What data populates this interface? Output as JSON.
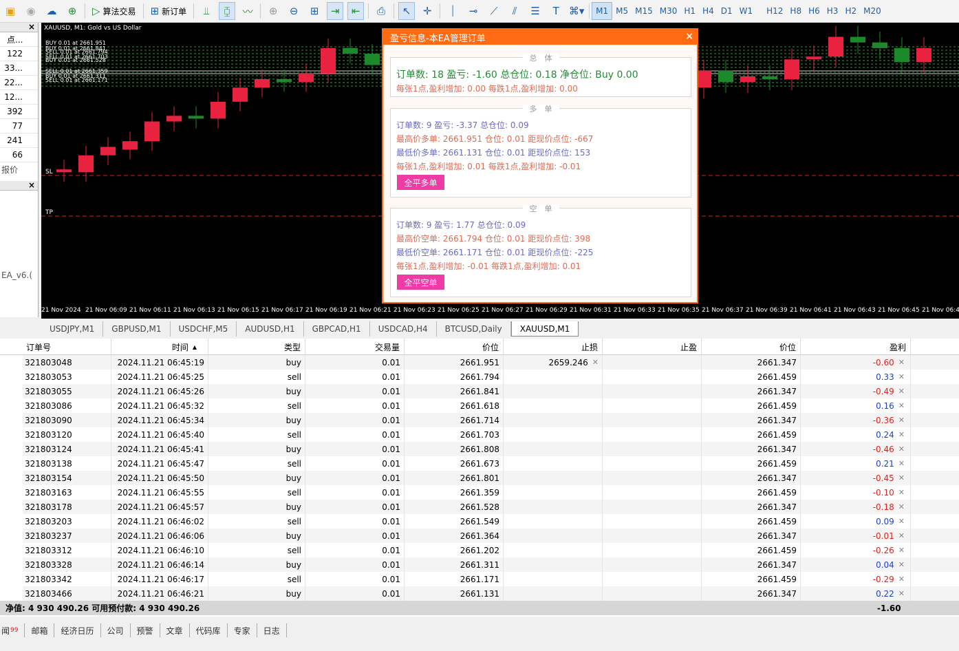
{
  "toolbar": {
    "algo_trading": "算法交易",
    "new_order": "新订单",
    "timeframes": [
      "M1",
      "M5",
      "M15",
      "M30",
      "H1",
      "H4",
      "D1",
      "W1",
      "H12",
      "H8",
      "H6",
      "H3",
      "H2",
      "M20"
    ],
    "active_tf": "M1"
  },
  "left_panel": {
    "header": "点...",
    "values": [
      "122",
      "33...",
      "22...",
      "12...",
      "392",
      "77",
      "241",
      "66"
    ],
    "label1": "报价",
    "label2": "EA_v6.("
  },
  "chart": {
    "title": "XAUUSD, M1:  Gold vs US Dollar",
    "lines": {
      "sl": "SL",
      "tp": "TP"
    },
    "order_labels": [
      "BUY 0.01 at 2661.951",
      "BUY 0.01 at 2661.841",
      "SELL 0.01 at 2661.794",
      "SELL 0.01 at 2661.703",
      "BUY 0.01 at 2661.528",
      "SELL 0.01 at 2661.359",
      "BUY 0.01 at 2661.311",
      "SELL 0.01 at 2661.171"
    ],
    "time_labels": [
      "21 Nov 2024",
      "21 Nov 06:09",
      "21 Nov 06:11",
      "21 Nov 06:13",
      "21 Nov 06:15",
      "21 Nov 06:17",
      "21 Nov 06:19",
      "21 Nov 06:21",
      "21 Nov 06:23",
      "21 Nov 06:25",
      "21 Nov 06:27",
      "21 Nov 06:29",
      "21 Nov 06:31",
      "21 Nov 06:33",
      "21 Nov 06:35",
      "21 Nov 06:37",
      "21 Nov 06:39",
      "21 Nov 06:41",
      "21 Nov 06:43",
      "21 Nov 06:45",
      "21 Nov 06:4"
    ],
    "candles": [
      {
        "dir": "down",
        "o": 0.52,
        "c": 0.53
      },
      {
        "dir": "down",
        "o": 0.47,
        "c": 0.53
      },
      {
        "dir": "down",
        "o": 0.44,
        "c": 0.47
      },
      {
        "dir": "down",
        "o": 0.42,
        "c": 0.45
      },
      {
        "dir": "down",
        "o": 0.35,
        "c": 0.42
      },
      {
        "dir": "down",
        "o": 0.33,
        "c": 0.35
      },
      {
        "dir": "up",
        "o": 0.34,
        "c": 0.33
      },
      {
        "dir": "down",
        "o": 0.28,
        "c": 0.34
      },
      {
        "dir": "down",
        "o": 0.23,
        "c": 0.28
      },
      {
        "dir": "down",
        "o": 0.2,
        "c": 0.23
      },
      {
        "dir": "up",
        "o": 0.21,
        "c": 0.2
      },
      {
        "dir": "down",
        "o": 0.18,
        "c": 0.21
      },
      {
        "dir": "down",
        "o": 0.09,
        "c": 0.18
      },
      {
        "dir": "up",
        "o": 0.11,
        "c": 0.09
      },
      {
        "dir": "up",
        "o": 0.15,
        "c": 0.11
      },
      {
        "dir": "up",
        "o": 0.26,
        "c": 0.15
      }
    ],
    "right_candles": [
      {
        "dir": "down",
        "o": 0.17,
        "c": 0.23
      },
      {
        "dir": "up",
        "o": 0.21,
        "c": 0.17
      },
      {
        "dir": "down",
        "o": 0.19,
        "c": 0.21
      },
      {
        "dir": "up",
        "o": 0.2,
        "c": 0.19
      },
      {
        "dir": "down",
        "o": 0.13,
        "c": 0.2
      },
      {
        "dir": "down",
        "o": 0.12,
        "c": 0.13
      },
      {
        "dir": "down",
        "o": 0.05,
        "c": 0.12
      },
      {
        "dir": "up",
        "o": 0.07,
        "c": 0.05
      },
      {
        "dir": "up",
        "o": 0.09,
        "c": 0.07
      },
      {
        "dir": "up",
        "o": 0.14,
        "c": 0.09
      },
      {
        "dir": "down",
        "o": 0.09,
        "c": 0.14
      }
    ]
  },
  "symbol_tabs": [
    "USDJPY,M1",
    "GBPUSD,M1",
    "USDCHF,M5",
    "AUDUSD,H1",
    "GBPCAD,H1",
    "USDCAD,H4",
    "BTCUSD,Daily",
    "XAUUSD,M1"
  ],
  "active_tab": "XAUUSD,M1",
  "popup": {
    "title": "盈亏信息-本EA管理订单",
    "close": "×",
    "total": {
      "heading": "总　体",
      "line1": "订单数: 18  盈亏: -1.60  总仓位: 0.18  净仓位: Buy 0.00",
      "line2": "每张1点,盈利增加: 0.00    每跌1点,盈利增加: 0.00"
    },
    "long": {
      "heading": "多　单",
      "line1": "订单数: 9  盈亏: -3.37  总仓位: 0.09",
      "line2": "最高价多单: 2661.951  仓位: 0.01  距现价点位: -667",
      "line3": "最低价多单: 2661.131  仓位: 0.01  距现价点位: 153",
      "line4": "每张1点,盈利增加: 0.01    每跌1点,盈利增加: -0.01",
      "button": "全平多单"
    },
    "short": {
      "heading": "空　单",
      "line1": "订单数: 9  盈亏: 1.77  总仓位: 0.09",
      "line2": "最高价空单: 2661.794  仓位: 0.01  距现价点位: 398",
      "line3": "最低价空单: 2661.171  仓位: 0.01  距现价点位: -225",
      "line4": "每张1点,盈利增加: -0.01    每跌1点,盈利增加: 0.01",
      "button": "全平空单"
    }
  },
  "table": {
    "headers": [
      "订单号",
      "时间",
      "类型",
      "交易量",
      "价位",
      "止损",
      "止盈",
      "价位",
      "盈利"
    ],
    "rows": [
      {
        "id": "321803048",
        "time": "2024.11.21 06:45:19",
        "type": "buy",
        "vol": "0.01",
        "price": "2661.951",
        "sl": "2659.246",
        "tp": "",
        "cur": "2661.347",
        "profit": "-0.60",
        "sign": "neg"
      },
      {
        "id": "321803053",
        "time": "2024.11.21 06:45:25",
        "type": "sell",
        "vol": "0.01",
        "price": "2661.794",
        "sl": "",
        "tp": "",
        "cur": "2661.459",
        "profit": "0.33",
        "sign": "pos"
      },
      {
        "id": "321803055",
        "time": "2024.11.21 06:45:26",
        "type": "buy",
        "vol": "0.01",
        "price": "2661.841",
        "sl": "",
        "tp": "",
        "cur": "2661.347",
        "profit": "-0.49",
        "sign": "neg"
      },
      {
        "id": "321803086",
        "time": "2024.11.21 06:45:32",
        "type": "sell",
        "vol": "0.01",
        "price": "2661.618",
        "sl": "",
        "tp": "",
        "cur": "2661.459",
        "profit": "0.16",
        "sign": "pos"
      },
      {
        "id": "321803090",
        "time": "2024.11.21 06:45:34",
        "type": "buy",
        "vol": "0.01",
        "price": "2661.714",
        "sl": "",
        "tp": "",
        "cur": "2661.347",
        "profit": "-0.36",
        "sign": "neg"
      },
      {
        "id": "321803120",
        "time": "2024.11.21 06:45:40",
        "type": "sell",
        "vol": "0.01",
        "price": "2661.703",
        "sl": "",
        "tp": "",
        "cur": "2661.459",
        "profit": "0.24",
        "sign": "pos"
      },
      {
        "id": "321803124",
        "time": "2024.11.21 06:45:41",
        "type": "buy",
        "vol": "0.01",
        "price": "2661.808",
        "sl": "",
        "tp": "",
        "cur": "2661.347",
        "profit": "-0.46",
        "sign": "neg"
      },
      {
        "id": "321803138",
        "time": "2024.11.21 06:45:47",
        "type": "sell",
        "vol": "0.01",
        "price": "2661.673",
        "sl": "",
        "tp": "",
        "cur": "2661.459",
        "profit": "0.21",
        "sign": "pos"
      },
      {
        "id": "321803154",
        "time": "2024.11.21 06:45:50",
        "type": "buy",
        "vol": "0.01",
        "price": "2661.801",
        "sl": "",
        "tp": "",
        "cur": "2661.347",
        "profit": "-0.45",
        "sign": "neg"
      },
      {
        "id": "321803163",
        "time": "2024.11.21 06:45:55",
        "type": "sell",
        "vol": "0.01",
        "price": "2661.359",
        "sl": "",
        "tp": "",
        "cur": "2661.459",
        "profit": "-0.10",
        "sign": "neg"
      },
      {
        "id": "321803178",
        "time": "2024.11.21 06:45:57",
        "type": "buy",
        "vol": "0.01",
        "price": "2661.528",
        "sl": "",
        "tp": "",
        "cur": "2661.347",
        "profit": "-0.18",
        "sign": "neg"
      },
      {
        "id": "321803203",
        "time": "2024.11.21 06:46:02",
        "type": "sell",
        "vol": "0.01",
        "price": "2661.549",
        "sl": "",
        "tp": "",
        "cur": "2661.459",
        "profit": "0.09",
        "sign": "pos"
      },
      {
        "id": "321803237",
        "time": "2024.11.21 06:46:06",
        "type": "buy",
        "vol": "0.01",
        "price": "2661.364",
        "sl": "",
        "tp": "",
        "cur": "2661.347",
        "profit": "-0.01",
        "sign": "neg"
      },
      {
        "id": "321803312",
        "time": "2024.11.21 06:46:10",
        "type": "sell",
        "vol": "0.01",
        "price": "2661.202",
        "sl": "",
        "tp": "",
        "cur": "2661.459",
        "profit": "-0.26",
        "sign": "neg"
      },
      {
        "id": "321803328",
        "time": "2024.11.21 06:46:14",
        "type": "buy",
        "vol": "0.01",
        "price": "2661.311",
        "sl": "",
        "tp": "",
        "cur": "2661.347",
        "profit": "0.04",
        "sign": "pos"
      },
      {
        "id": "321803342",
        "time": "2024.11.21 06:46:17",
        "type": "sell",
        "vol": "0.01",
        "price": "2661.171",
        "sl": "",
        "tp": "",
        "cur": "2661.459",
        "profit": "-0.29",
        "sign": "neg"
      },
      {
        "id": "321803466",
        "time": "2024.11.21 06:46:21",
        "type": "buy",
        "vol": "0.01",
        "price": "2661.131",
        "sl": "",
        "tp": "",
        "cur": "2661.347",
        "profit": "0.22",
        "sign": "pos"
      }
    ],
    "summary_text": "净值: 4 930 490.26  可用预付款: 4 930 490.26",
    "summary_profit": "-1.60"
  },
  "bottom_tabs": [
    "闻",
    "邮箱",
    "经济日历",
    "公司",
    "预警",
    "文章",
    "代码库",
    "专家",
    "日志"
  ],
  "bottom_badge": "99"
}
